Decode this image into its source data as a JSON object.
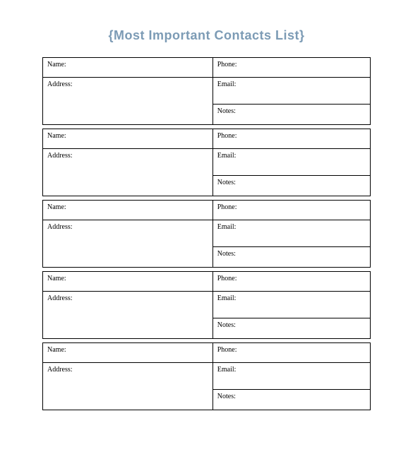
{
  "title": "{Most Important Contacts List}",
  "labels": {
    "name": "Name:",
    "phone": "Phone:",
    "address": "Address:",
    "email": "Email:",
    "notes": "Notes:"
  },
  "contacts": [
    {
      "name": "",
      "phone": "",
      "address": "",
      "email": "",
      "notes": ""
    },
    {
      "name": "",
      "phone": "",
      "address": "",
      "email": "",
      "notes": ""
    },
    {
      "name": "",
      "phone": "",
      "address": "",
      "email": "",
      "notes": ""
    },
    {
      "name": "",
      "phone": "",
      "address": "",
      "email": "",
      "notes": ""
    },
    {
      "name": "",
      "phone": "",
      "address": "",
      "email": "",
      "notes": ""
    }
  ]
}
